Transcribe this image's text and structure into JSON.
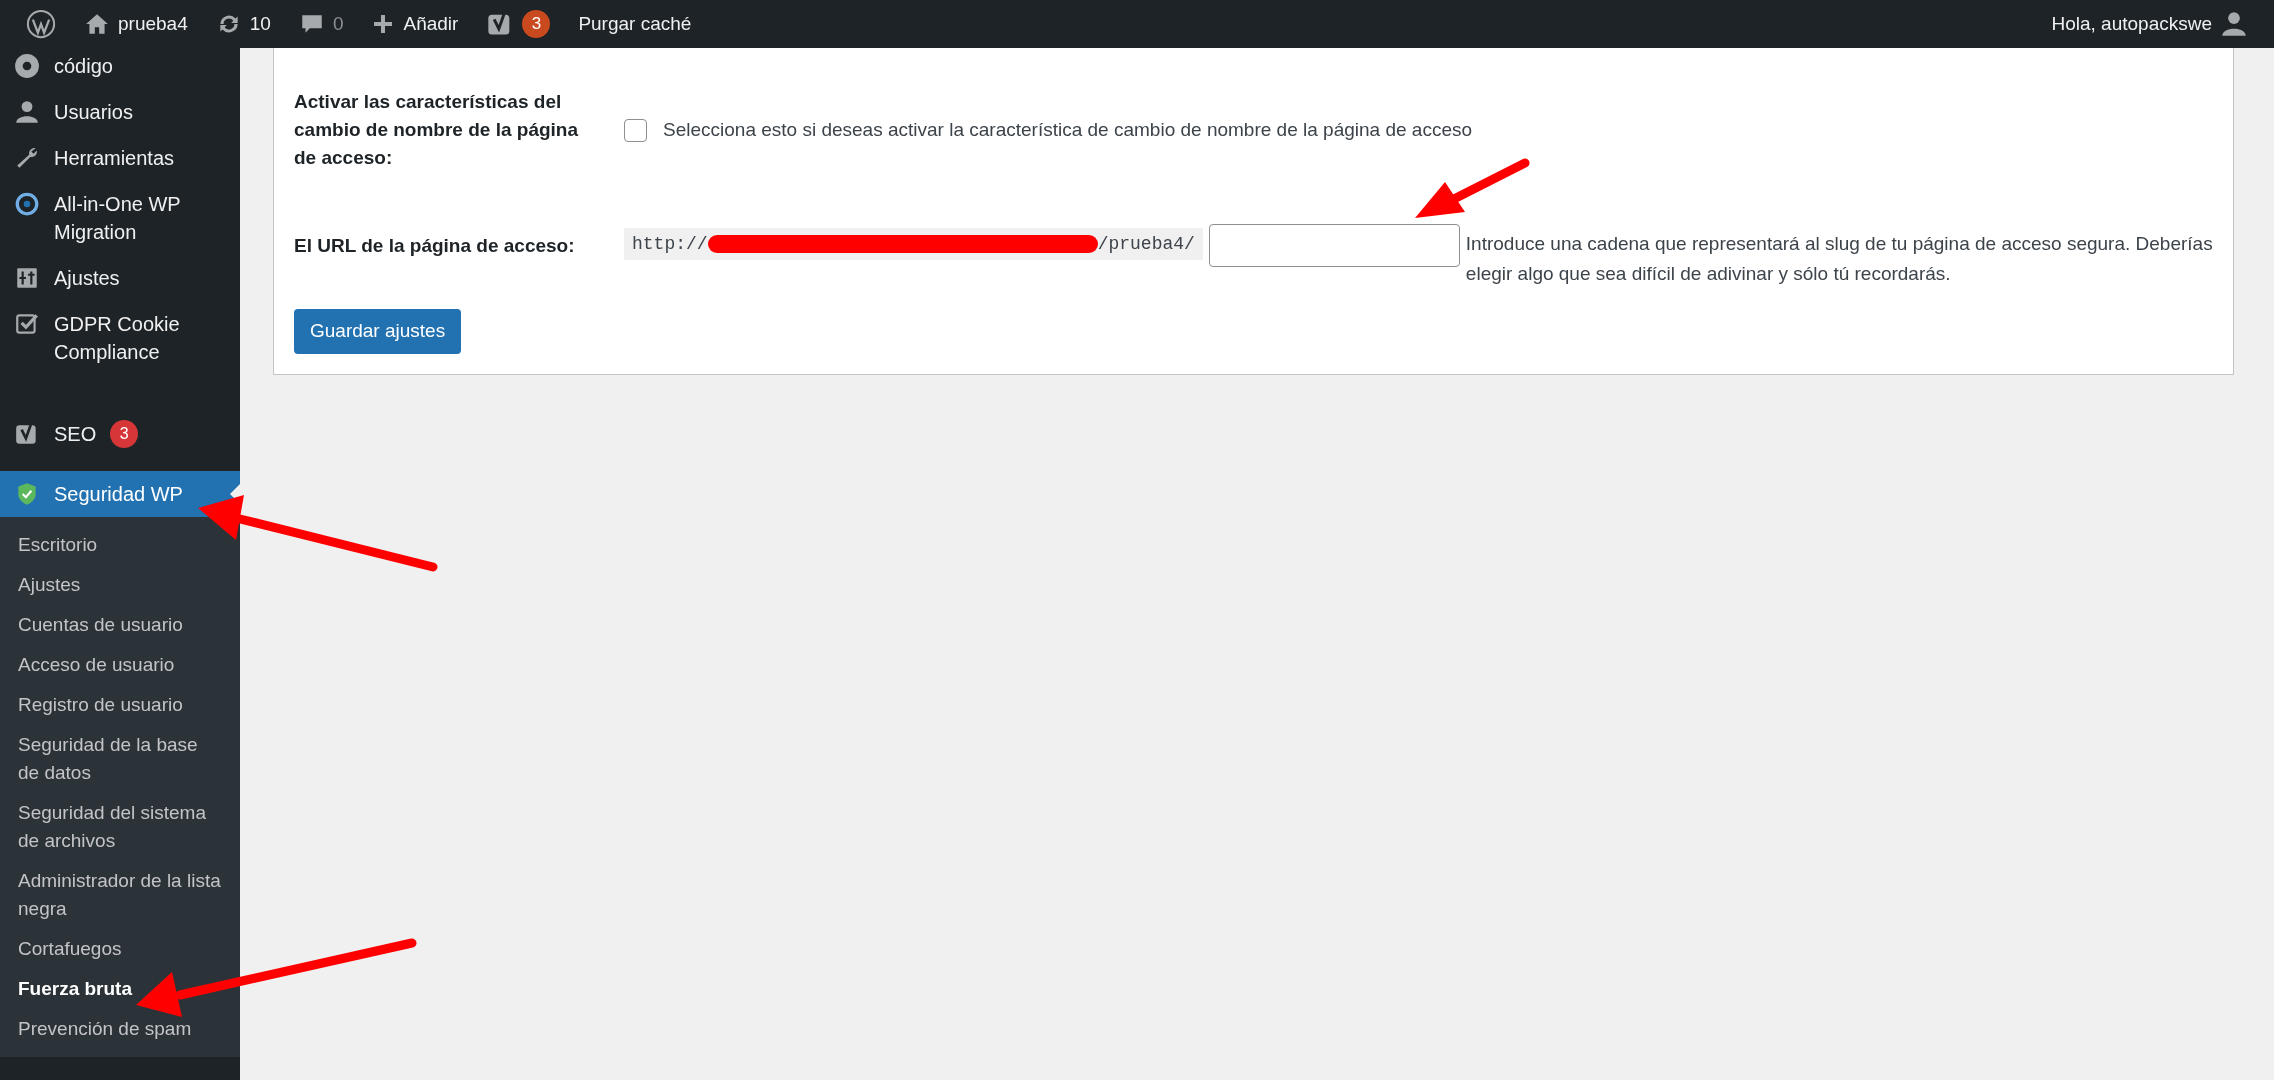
{
  "top_bar": {
    "items": [
      {
        "kind": "logo"
      },
      {
        "kind": "site",
        "label": "prueba4"
      },
      {
        "kind": "updates",
        "label": "10"
      },
      {
        "kind": "comments",
        "label": "0",
        "disabled": true
      },
      {
        "kind": "new",
        "label": "Añadir"
      },
      {
        "kind": "seo",
        "badge": "3"
      },
      {
        "kind": "text",
        "label": "Purgar caché"
      }
    ],
    "greeting": "Hola, autopackswe"
  },
  "sidebar": {
    "items": [
      {
        "label": "código",
        "selected": false
      },
      {
        "label": "Usuarios",
        "selected": false
      },
      {
        "label": "Herramientas",
        "selected": false
      },
      {
        "label": "All-in-One WP Migration",
        "selected": false
      },
      {
        "label": "Ajustes",
        "selected": false
      },
      {
        "label": "GDPR Cookie Compliance",
        "selected": false
      },
      {
        "label": "SEO",
        "badge": "3",
        "selected": false
      },
      {
        "label": "Seguridad WP",
        "selected": true,
        "children": [
          {
            "label": "Escritorio",
            "selected": false
          },
          {
            "label": "Ajustes",
            "selected": false
          },
          {
            "label": "Cuentas de usuario",
            "selected": false
          },
          {
            "label": "Acceso de usuario",
            "selected": false
          },
          {
            "label": "Registro de usuario",
            "selected": false
          },
          {
            "label": "Seguridad de la base de datos",
            "selected": false
          },
          {
            "label": "Seguridad del sistema de archivos",
            "selected": false
          },
          {
            "label": "Administrador de la lista negra",
            "selected": false
          },
          {
            "label": "Cortafuegos",
            "selected": false
          },
          {
            "label": "Fuerza bruta",
            "selected": true
          },
          {
            "label": "Prevención de spam",
            "selected": false
          }
        ]
      }
    ]
  },
  "form": {
    "rename_row": {
      "label": "Activar las características del cambio de nombre de la página de acceso:",
      "checked": false,
      "description": "Selecciona esto si deseas activar la característica de cambio de nombre de la página de acceso"
    },
    "url_row": {
      "label": "El URL de la página de acceso:",
      "url_prefix": "http://",
      "url_suffix": "/prueba4/",
      "description": "Introduce una cadena que representará al slug de tu página de acceso segura. Deberías elegir algo que sea difícil de adivinar y sólo tú recordarás."
    },
    "save_button": "Guardar ajustes"
  }
}
